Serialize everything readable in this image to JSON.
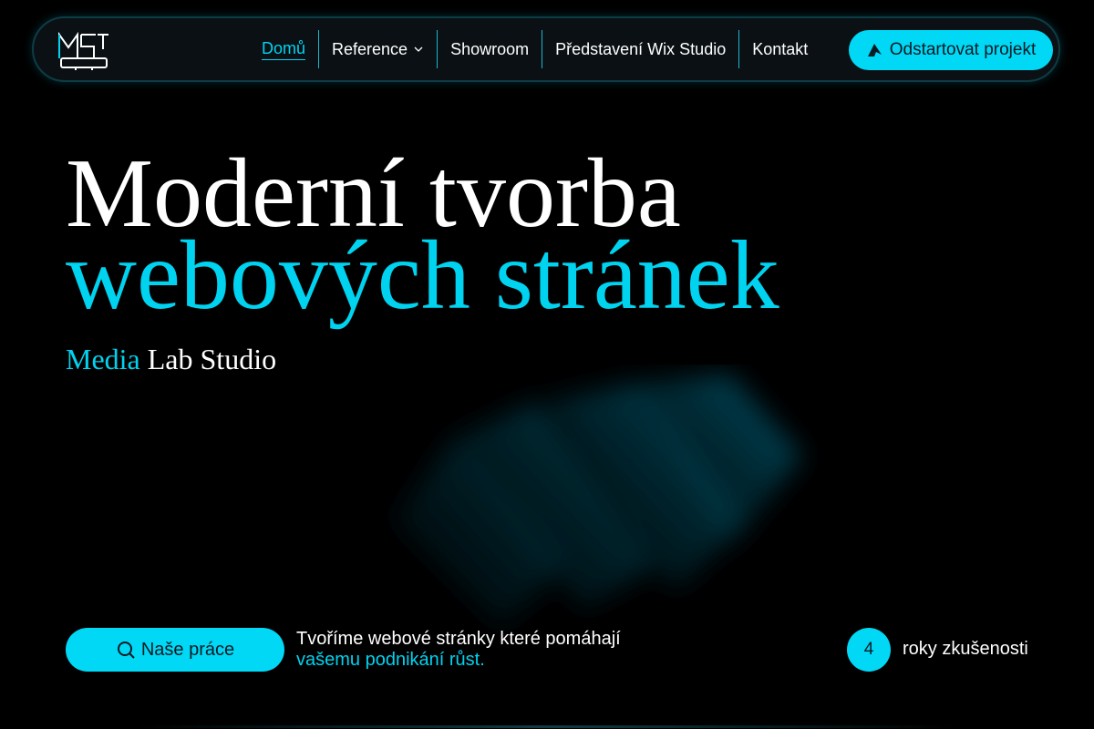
{
  "brand": {
    "logo_text": "MLS"
  },
  "nav": {
    "items": [
      {
        "label": "Domů",
        "active": true
      },
      {
        "label": "Reference",
        "has_dropdown": true
      },
      {
        "label": "Showroom"
      },
      {
        "label": "Představení Wix Studio"
      },
      {
        "label": "Kontakt"
      }
    ],
    "cta_label": "Odstartovat projekt"
  },
  "hero": {
    "title_line1": "Moderní tvorba",
    "title_line2": "webových stránek",
    "subtitle_accent": "Media",
    "subtitle_rest": "Lab Studio"
  },
  "footer_bar": {
    "button_label": "Naše práce",
    "tagline_line1": "Tvoříme webové stránky které pomáhají",
    "tagline_line2": "vašemu podnikání růst.",
    "years_value": "4",
    "years_label": "roky zkušenosti"
  },
  "colors": {
    "accent": "#00d3f0",
    "button_bg": "#00d8f5",
    "background": "#000000",
    "nav_bg": "#0b1014"
  },
  "icons": {
    "cta": "rocket-icon",
    "button": "search-icon",
    "dropdown": "chevron-down-icon"
  }
}
